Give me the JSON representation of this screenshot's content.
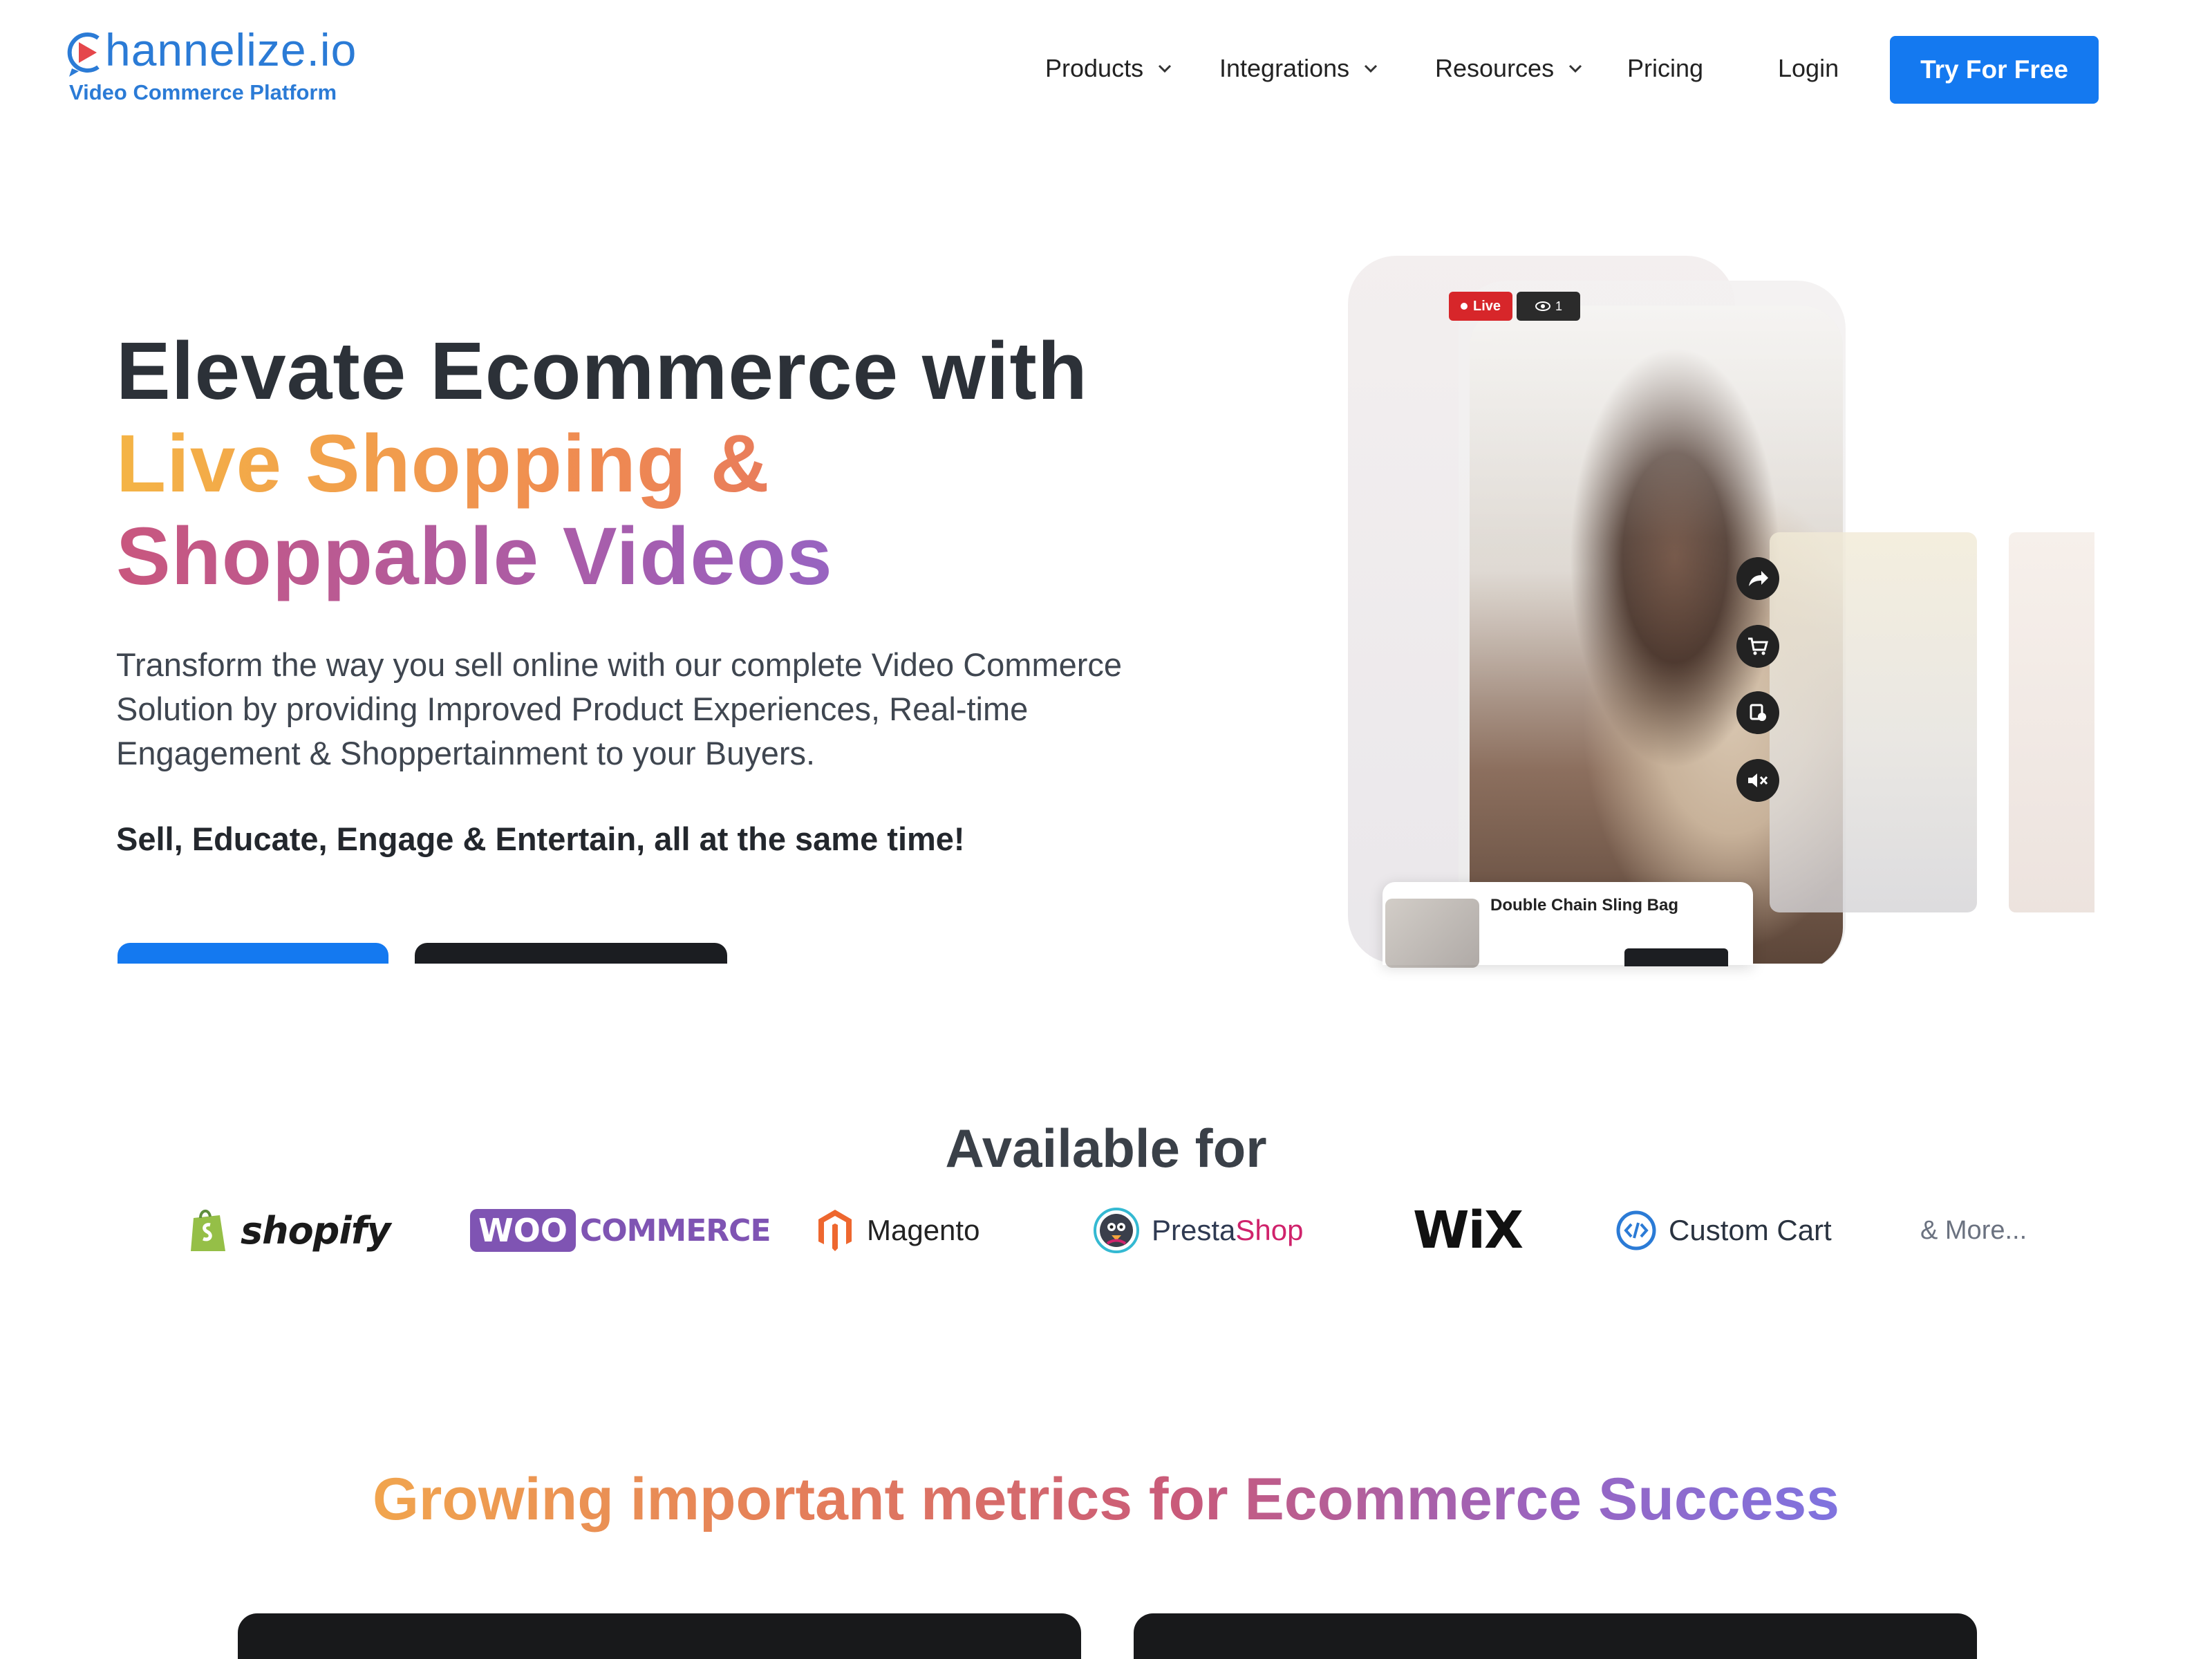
{
  "brand": {
    "logo_first": "C",
    "logo_rest": "hannelize",
    "logo_suffix": ".io",
    "tagline": "Video Commerce Platform",
    "primary_color": "#1479f0"
  },
  "nav": {
    "items": [
      {
        "label": "Products",
        "has_dropdown": true
      },
      {
        "label": "Integrations",
        "has_dropdown": true
      },
      {
        "label": "Resources",
        "has_dropdown": true
      },
      {
        "label": "Pricing",
        "has_dropdown": false
      }
    ],
    "login": "Login",
    "cta": "Try For Free"
  },
  "hero": {
    "title_line1": "Elevate Ecommerce with",
    "title_line2": "Live Shopping &",
    "title_line3": "Shoppable Videos",
    "description": "Transform the way you sell online with our complete Video Commerce Solution by providing Improved Product Experiences, Real-time Engagement & Shoppertainment to your Buyers.",
    "tagline": "Sell, Educate, Engage & Entertain, all at the same time!",
    "visual": {
      "live_label": "Live",
      "viewer_count": "1",
      "product_name": "Double Chain Sling Bag",
      "side_icons": [
        "share-icon",
        "cart-icon",
        "wishlist-icon",
        "mute-icon"
      ]
    }
  },
  "available": {
    "title": "Available for",
    "platforms": [
      {
        "name": "shopify",
        "icon": "shopify-bag-icon"
      },
      {
        "name_box": "WOO",
        "name": "COMMERCE",
        "icon": "woocommerce-logo"
      },
      {
        "name": "Magento",
        "icon": "magento-icon"
      },
      {
        "name_a": "Presta",
        "name_b": "Shop",
        "icon": "prestashop-icon"
      },
      {
        "name": "WiX",
        "icon": "wix-logo"
      },
      {
        "name": "Custom Cart",
        "icon": "code-icon"
      },
      {
        "name": "& More..."
      }
    ]
  },
  "metrics": {
    "title": "Growing important metrics for Ecommerce Success"
  }
}
